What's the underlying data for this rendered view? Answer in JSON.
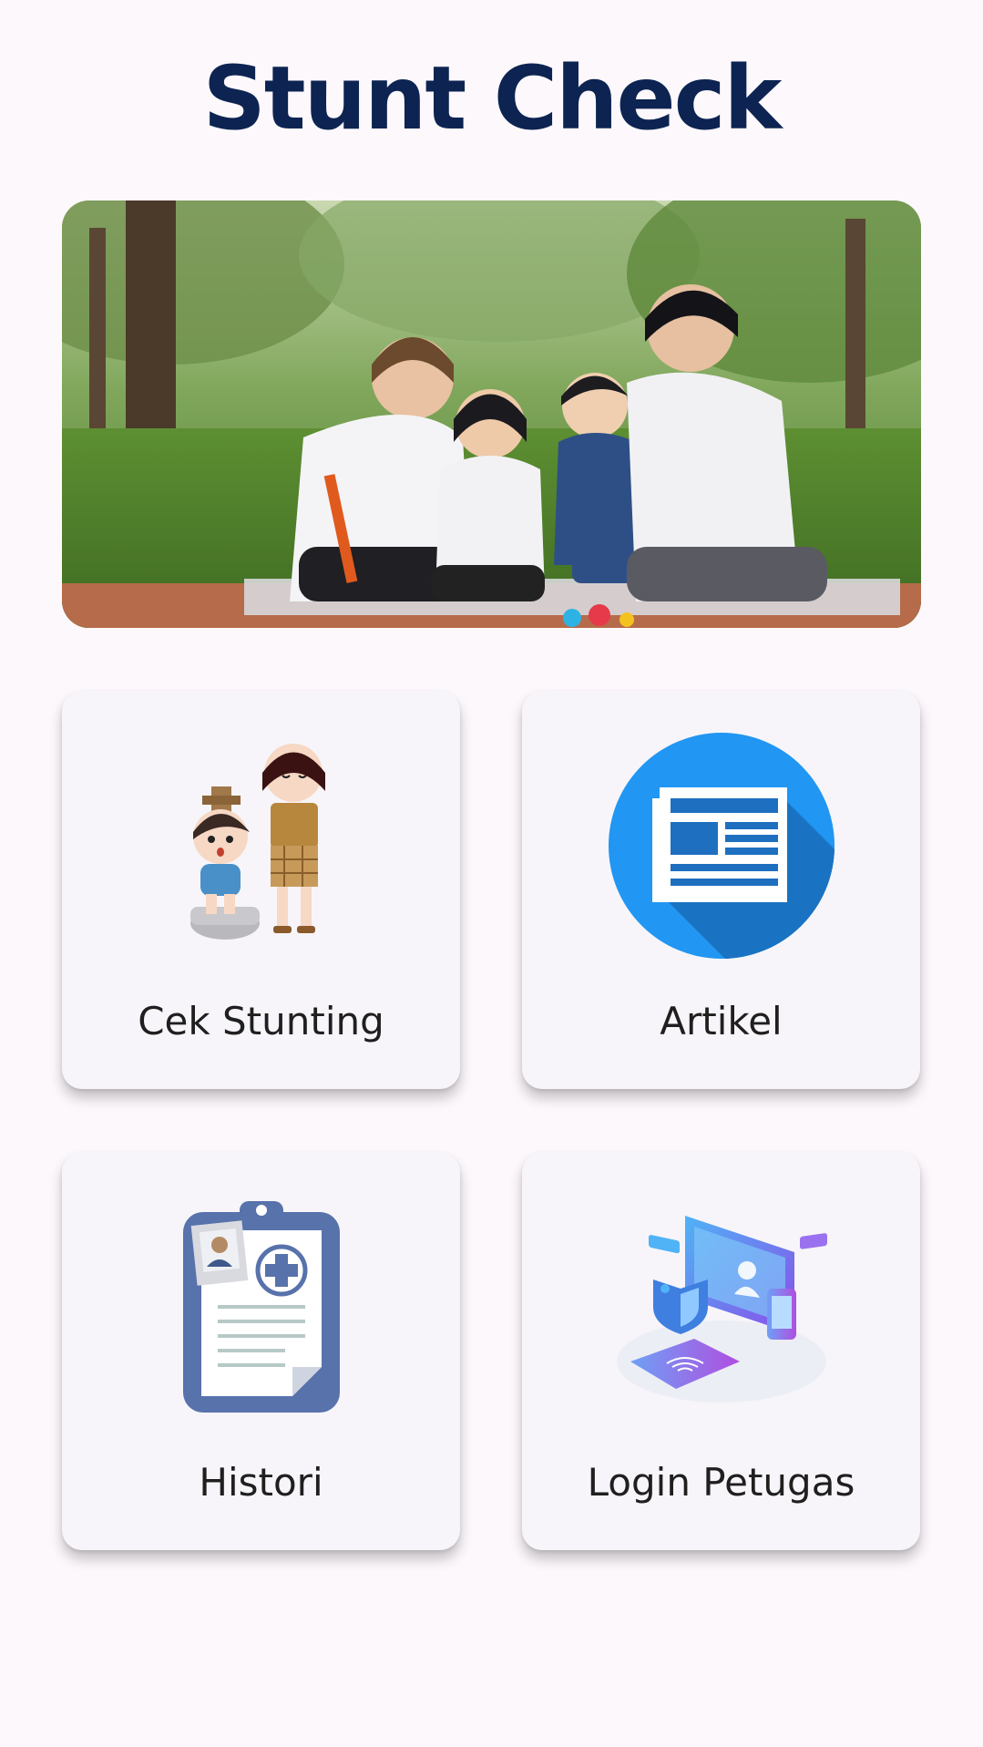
{
  "app": {
    "title": "Stunt Check"
  },
  "hero": {
    "image": "family-photo"
  },
  "menu": [
    {
      "label": "Cek Stunting",
      "icon": "height-measure-icon"
    },
    {
      "label": "Artikel",
      "icon": "newspaper-icon"
    },
    {
      "label": "Histori",
      "icon": "medical-clipboard-icon"
    },
    {
      "label": "Login Petugas",
      "icon": "secure-login-icon"
    }
  ],
  "colors": {
    "title": "#0d2452",
    "background": "#fdf8fc",
    "card": "#f7f5f9",
    "article_accent": "#2196f3"
  }
}
